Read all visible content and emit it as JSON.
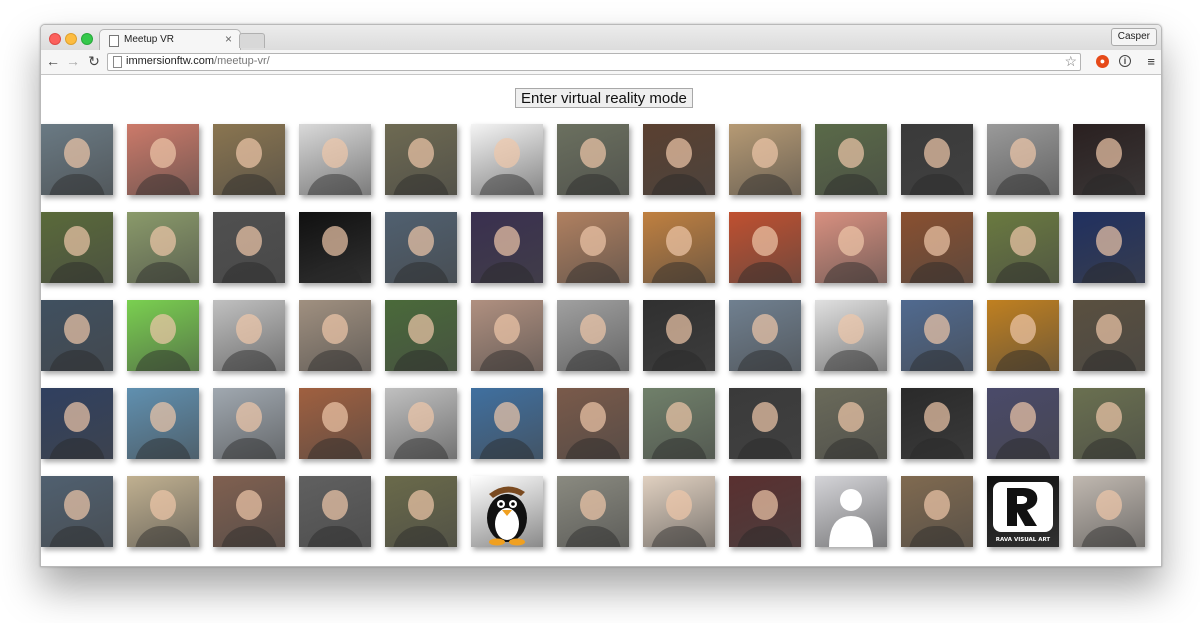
{
  "browser": {
    "tab_title": "Meetup VR",
    "tab_close": "×",
    "profile_name": "Casper",
    "url_host": "immersionftw.com",
    "url_path": "/meetup-vr/",
    "icons": {
      "back": "back-arrow-icon",
      "forward": "forward-arrow-icon",
      "reload": "reload-icon",
      "bookmark": "star-icon",
      "extension": "extension-icon",
      "info": "info-icon",
      "menu": "hamburger-menu-icon"
    }
  },
  "page": {
    "vr_button_label": "Enter virtual reality mode",
    "members": [
      [
        "#6a7a84",
        "#cc7a6a",
        "#8a7550",
        "#d9d9d9",
        "#6e6a52",
        "#f4f4f4",
        "#6b705f",
        "#5a4030",
        "#b69a74",
        "#5a6a48",
        "#3a3a3a",
        "#9a9a9a",
        "#2a2020"
      ],
      [
        "#5a6a3a",
        "#8a9a6a",
        "#505050",
        "#101010",
        "#506070",
        "#3a3050",
        "#b08060",
        "#c08040",
        "#c05030",
        "#d89080",
        "#8a5030",
        "#6a7a40",
        "#203060"
      ],
      [
        "#405060",
        "#7ad050",
        "#c0c0c0",
        "#a09080",
        "#4a6a3a",
        "#b09080",
        "#a0a0a0",
        "#303030",
        "#708090",
        "#e0e0e0",
        "#506a90",
        "#c08020",
        "#5a5040"
      ],
      [
        "#304060",
        "#6090b0",
        "#a0a8b0",
        "#a06040",
        "#c0c0c0",
        "#4070a0",
        "#7a5a4a",
        "#70806a",
        "#3a3a3a",
        "#6a6a5a",
        "#2a2a2a",
        "#4a4a6a",
        "#6a7050"
      ],
      [
        "#506070",
        "#c0b090",
        "#806050",
        "#606060",
        "#6a6a4a",
        "#ffffff",
        "#8a8a80",
        "#e0d0c0",
        "#5a3030",
        "#d4d4d8",
        "#806a50",
        "#111111",
        "#c0b8b0"
      ]
    ],
    "special_labels": {
      "penguin_alt": "penguin avatar",
      "logo_text": "RAVA VISUAL ART"
    }
  }
}
